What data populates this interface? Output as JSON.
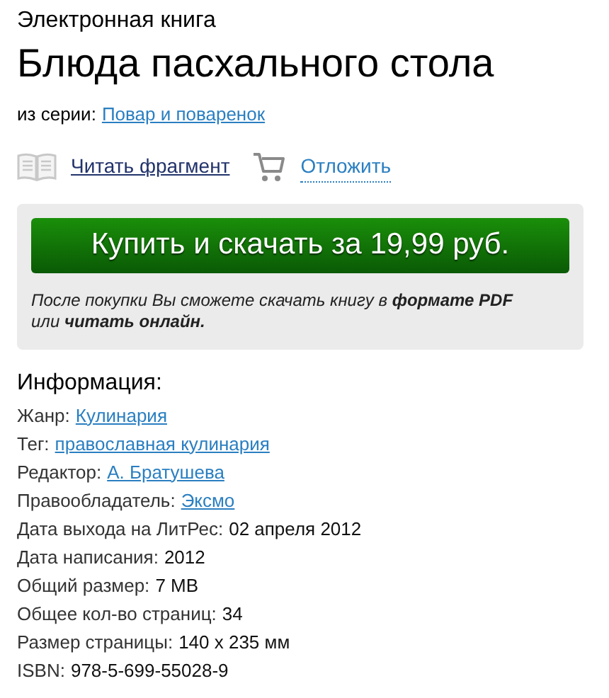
{
  "type_label": "Электронная книга",
  "title": "Блюда пасхального стола",
  "series": {
    "label": "из серии:",
    "link": "Повар и поваренок"
  },
  "actions": [
    {
      "kind": "read",
      "label": "Читать фрагмент"
    },
    {
      "kind": "defer",
      "label": "Отложить"
    }
  ],
  "buy": {
    "button": "Купить и скачать за 19,99 руб.",
    "note": "После покупки Вы сможете скачать книгу в **формате PDF** или **читать онлайн.**"
  },
  "info": {
    "heading": "Информация:",
    "rows": [
      {
        "label": "Жанр:",
        "value": "Кулинария",
        "kind": "link"
      },
      {
        "label": "Тег:",
        "value": "православная кулинария",
        "kind": "link"
      },
      {
        "label": "Редактор:",
        "value": "А. Братушева",
        "kind": "link"
      },
      {
        "label": "Правообладатель:",
        "value": "Эксмо",
        "kind": "link"
      },
      {
        "label": "Дата выхода на ЛитРес:",
        "value": "02 апреля 2012",
        "kind": "text"
      },
      {
        "label": "Дата написания:",
        "value": "2012",
        "kind": "text"
      },
      {
        "label": "Общий размер:",
        "value": "7 MB",
        "kind": "text"
      },
      {
        "label": "Общее кол-во страниц:",
        "value": "34",
        "kind": "text"
      },
      {
        "label": "Размер страницы:",
        "value": "140 x 235 мм",
        "kind": "text"
      },
      {
        "label": "ISBN:",
        "value": "978-5-699-55028-9",
        "kind": "text"
      }
    ]
  }
}
